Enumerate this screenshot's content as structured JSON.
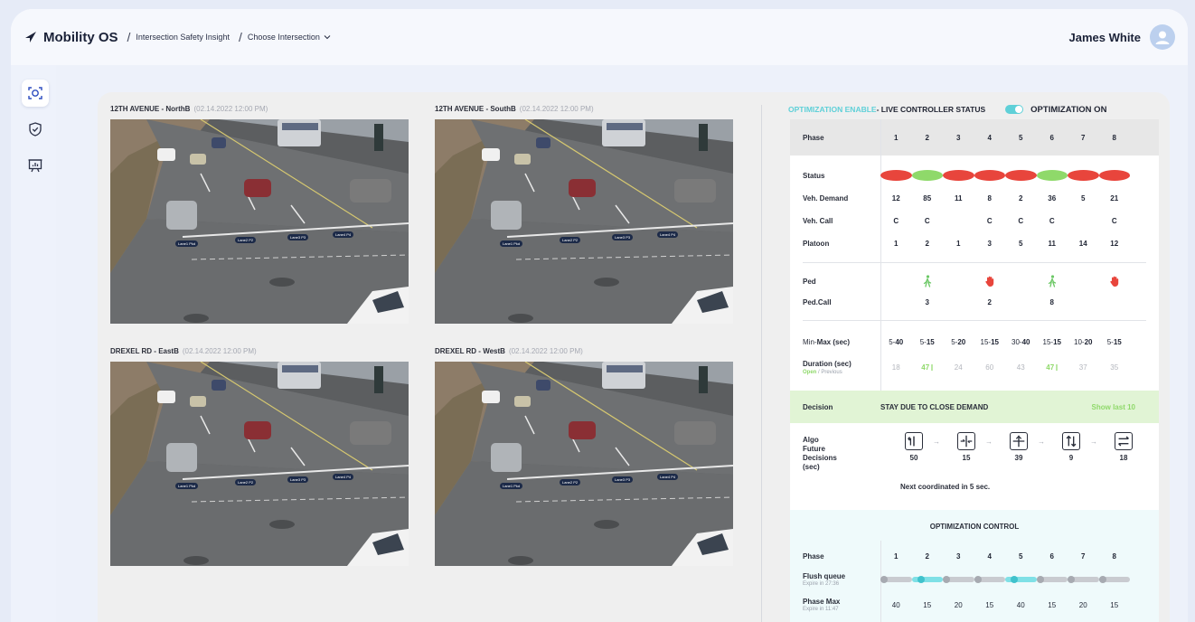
{
  "header": {
    "app_name": "Mobility OS",
    "breadcrumb_1": "Intersection Safety Insight",
    "breadcrumb_2": "Choose Intersection",
    "user_name": "James White"
  },
  "sidebar": {
    "items": [
      {
        "name": "camera-scan-icon",
        "active": true
      },
      {
        "name": "shield-check-icon",
        "active": false
      },
      {
        "name": "presentation-chart-icon",
        "active": false
      }
    ]
  },
  "cameras": [
    {
      "title": "12TH AVENUE - NorthB",
      "timestamp": "(02.14.2022  12:00 PM)",
      "lanes": [
        "Lane1 Pkd",
        "Lane2 P2",
        "Lane3 P3",
        "Lane4 P4"
      ]
    },
    {
      "title": "12TH AVENUE - SouthB",
      "timestamp": "(02.14.2022  12:00 PM)",
      "lanes": [
        "Lane1 Pkd",
        "Lane2 P2",
        "Lane3 P3",
        "Lane4 P4"
      ]
    },
    {
      "title": "DREXEL RD - EastB",
      "timestamp": "(02.14.2022  12:00 PM)",
      "lanes": [
        "Lane1 Pkd",
        "Lane2 P2",
        "Lane3 P3",
        "Lane4 P4"
      ]
    },
    {
      "title": "DREXEL RD - WestB",
      "timestamp": "(02.14.2022  12:00 PM)",
      "lanes": [
        "Lane1 Pkd",
        "Lane2 P2",
        "Lane3 P3",
        "Lane4 P4"
      ]
    }
  ],
  "status_header": {
    "optimization_enable": "OPTIMIZATION ENABLE",
    "live_status": " - LIVE CONTROLLER STATUS",
    "toggle_label": "OPTIMIZATION ON",
    "toggle_on": true
  },
  "controller": {
    "phase_label": "Phase",
    "phases": [
      "1",
      "2",
      "3",
      "4",
      "5",
      "6",
      "7",
      "8"
    ],
    "status_label": "Status",
    "status": [
      "red",
      "green",
      "red",
      "red",
      "red",
      "green",
      "red",
      "red"
    ],
    "veh_demand_label": "Veh. Demand",
    "veh_demand": [
      "12",
      "85",
      "11",
      "8",
      "2",
      "36",
      "5",
      "21"
    ],
    "veh_call_label": "Veh. Call",
    "veh_call": [
      "C",
      "C",
      "",
      "C",
      "C",
      "C",
      "",
      "C"
    ],
    "platoon_label": "Platoon",
    "platoon": [
      "1",
      "2",
      "1",
      "3",
      "5",
      "11",
      "14",
      "12"
    ],
    "ped_label": "Ped",
    "ped": [
      "",
      "walk",
      "",
      "stop",
      "",
      "walk",
      "",
      "stop"
    ],
    "ped_call_label": "Ped.Call",
    "ped_call": [
      "",
      "3",
      "",
      "2",
      "",
      "8",
      "",
      ""
    ],
    "minmax_label_prefix": "Min-",
    "minmax_label_bold": "Max (sec)",
    "minmax": [
      [
        "5-",
        "40"
      ],
      [
        "5-",
        "15"
      ],
      [
        "5-",
        "20"
      ],
      [
        "15-",
        "15"
      ],
      [
        "30-",
        "40"
      ],
      [
        "15-",
        "15"
      ],
      [
        "10-",
        "20"
      ],
      [
        "5-",
        "15"
      ]
    ],
    "duration_label": "Duration (sec)",
    "duration_open": "Open",
    "duration_prev": " / Previous",
    "duration": [
      "18",
      "47",
      "24",
      "60",
      "43",
      "47",
      "37",
      "35"
    ],
    "duration_active": [
      false,
      true,
      false,
      false,
      false,
      true,
      false,
      false
    ],
    "decision_label": "Decision",
    "decision_value": "STAY DUE TO CLOSE DEMAND",
    "decision_link": "Show last 10",
    "algo_label_1": "Algo",
    "algo_label_2": "Future",
    "algo_label_3": "Decisions",
    "algo_label_4": "(sec)",
    "algo_steps": [
      {
        "icon": "turn-left-arrows-icon",
        "value": "50"
      },
      {
        "icon": "cross-turn-icon",
        "value": "15"
      },
      {
        "icon": "cross-turn-alt-icon",
        "value": "39"
      },
      {
        "icon": "up-down-arrows-icon",
        "value": "9"
      },
      {
        "icon": "left-right-arrows-icon",
        "value": "18"
      }
    ],
    "next_coordinated": "Next coordinated in 5 sec."
  },
  "optimization_control": {
    "title": "OPTIMIZATION CONTROL",
    "phase_label": "Phase",
    "phases": [
      "1",
      "2",
      "3",
      "4",
      "5",
      "6",
      "7",
      "8"
    ],
    "flush_label": "Flush queue",
    "flush_sub": "Expire in 27:36",
    "flush": [
      false,
      true,
      false,
      false,
      true,
      false,
      false,
      false
    ],
    "phase_max_label": "Phase Max",
    "phase_max_sub": "Expire in 11:47",
    "phase_max": [
      "40",
      "15",
      "20",
      "15",
      "40",
      "15",
      "20",
      "15"
    ]
  },
  "colors": {
    "accent_teal": "#5fd0d8",
    "status_red": "#e8453c",
    "status_green": "#8fd96a",
    "ped_walk": "#6cc866",
    "ped_stop": "#e8453c",
    "decision_bg": "#e1f4d5"
  }
}
